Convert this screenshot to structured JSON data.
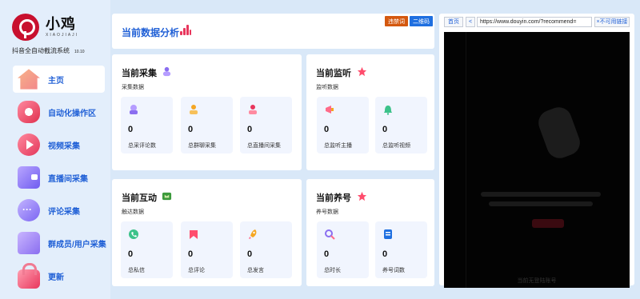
{
  "app": {
    "brand_name": "小鸡",
    "brand_sub": "XIAOJIAJI",
    "subtitle": "抖音全自动截流系统",
    "version": "10.10"
  },
  "sidebar": {
    "items": [
      {
        "label": "主页",
        "icon": "home-icon",
        "active": true
      },
      {
        "label": "自动化操作区",
        "icon": "gear-icon",
        "active": false
      },
      {
        "label": "视频采集",
        "icon": "play-icon",
        "active": false
      },
      {
        "label": "直播间采集",
        "icon": "wallet-icon",
        "active": false
      },
      {
        "label": "评论采集",
        "icon": "chat-icon",
        "active": false
      },
      {
        "label": "群成员/用户采集",
        "icon": "group-icon",
        "active": false
      },
      {
        "label": "更新",
        "icon": "lock-icon",
        "active": false
      }
    ]
  },
  "header": {
    "title": "当前数据分析",
    "btn_blocked": "违禁词",
    "btn_qrcode": "二维码"
  },
  "cards": {
    "collect": {
      "title": "当前采集",
      "sub": "采集数据",
      "stats": [
        {
          "value": "0",
          "label": "总采评论数"
        },
        {
          "value": "0",
          "label": "总群聊采集"
        },
        {
          "value": "0",
          "label": "总直播间采集"
        }
      ]
    },
    "monitor": {
      "title": "当前监听",
      "sub": "监听数据",
      "stats": [
        {
          "value": "0",
          "label": "总监听主播"
        },
        {
          "value": "0",
          "label": "总监听视频"
        }
      ]
    },
    "interact": {
      "title": "当前互动",
      "sub": "触达数据",
      "stats": [
        {
          "value": "0",
          "label": "总私信"
        },
        {
          "value": "0",
          "label": "总评论"
        },
        {
          "value": "0",
          "label": "总发言"
        }
      ]
    },
    "nurture": {
      "title": "当前养号",
      "sub": "养号数据",
      "stats": [
        {
          "value": "0",
          "label": "总时长"
        },
        {
          "value": "0",
          "label": "养号词数"
        }
      ]
    }
  },
  "browser": {
    "home_label": "首页",
    "back_label": "<",
    "url": "https://www.douyin.com/?recommend=",
    "unavailable_label": "×不可用链接",
    "footer": "当前无登陆账号"
  },
  "colors": {
    "accent": "#1f5fd6",
    "background": "#d9e8f8",
    "blocked_btn": "#d4580f",
    "qrcode_btn": "#1f6fe0"
  }
}
